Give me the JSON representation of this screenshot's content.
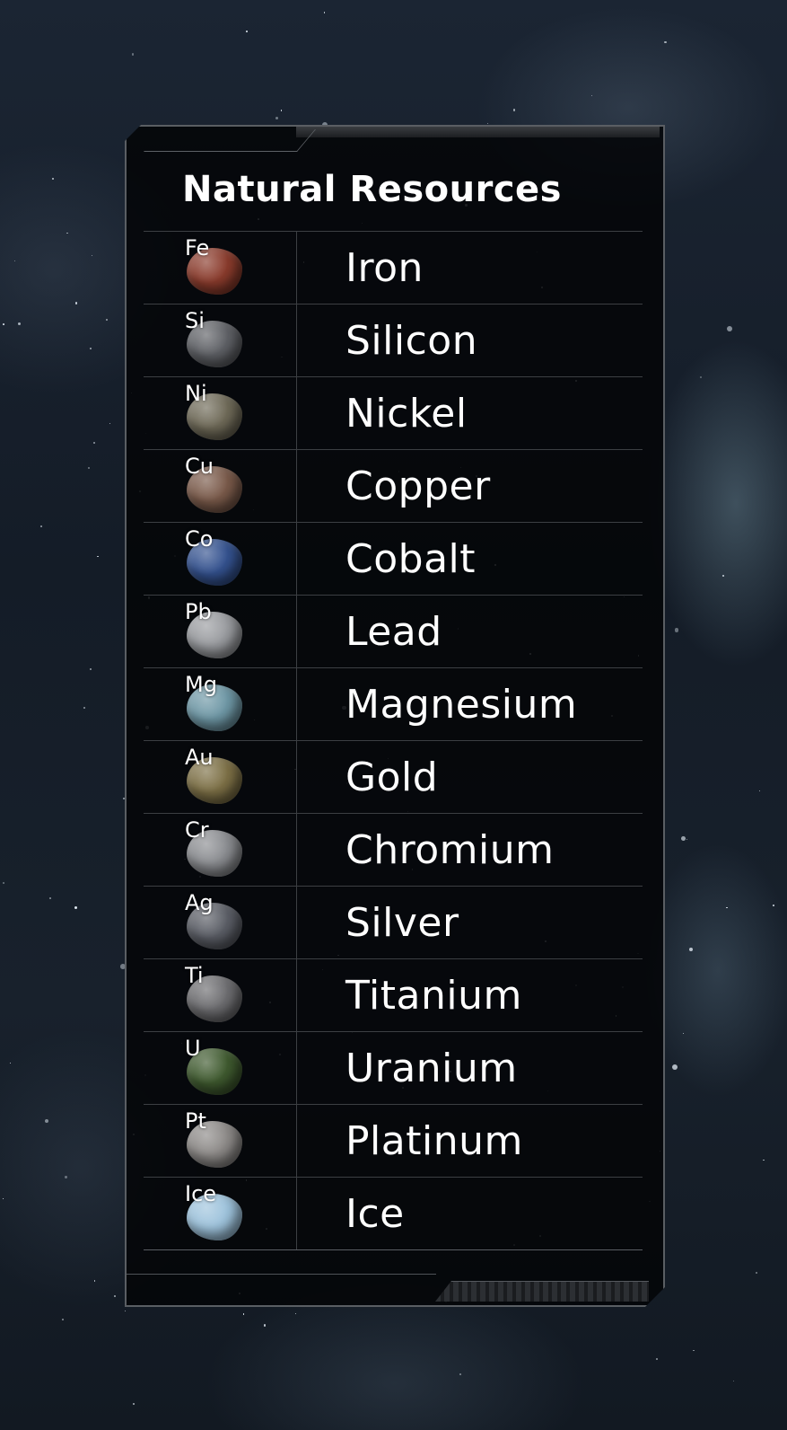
{
  "panel": {
    "title": "Natural Resources"
  },
  "resources": [
    {
      "symbol": "Fe",
      "name": "Iron",
      "icon": "iron-ore-icon",
      "color": "#8a3b2c"
    },
    {
      "symbol": "Si",
      "name": "Silicon",
      "icon": "silicon-ore-icon",
      "color": "#5f6166"
    },
    {
      "symbol": "Ni",
      "name": "Nickel",
      "icon": "nickel-ore-icon",
      "color": "#6f6a58"
    },
    {
      "symbol": "Cu",
      "name": "Copper",
      "icon": "copper-ore-icon",
      "color": "#7a5a4a"
    },
    {
      "symbol": "Co",
      "name": "Cobalt",
      "icon": "cobalt-ore-icon",
      "color": "#34528f"
    },
    {
      "symbol": "Pb",
      "name": "Lead",
      "icon": "lead-ore-icon",
      "color": "#9a9ca0"
    },
    {
      "symbol": "Mg",
      "name": "Magnesium",
      "icon": "magnesium-ore-icon",
      "color": "#6f98a6"
    },
    {
      "symbol": "Au",
      "name": "Gold",
      "icon": "gold-ore-icon",
      "color": "#7d7046"
    },
    {
      "symbol": "Cr",
      "name": "Chromium",
      "icon": "chromium-ore-icon",
      "color": "#8b8d91"
    },
    {
      "symbol": "Ag",
      "name": "Silver",
      "icon": "silver-ore-icon",
      "color": "#5b5e66"
    },
    {
      "symbol": "Ti",
      "name": "Titanium",
      "icon": "titanium-ore-icon",
      "color": "#6d6d70"
    },
    {
      "symbol": "U",
      "name": "Uranium",
      "icon": "uranium-ore-icon",
      "color": "#3f5a2f"
    },
    {
      "symbol": "Pt",
      "name": "Platinum",
      "icon": "platinum-ore-icon",
      "color": "#8d8a88"
    },
    {
      "symbol": "Ice",
      "name": "Ice",
      "icon": "ice-crystal-icon",
      "color": "#9ec3dc"
    }
  ]
}
